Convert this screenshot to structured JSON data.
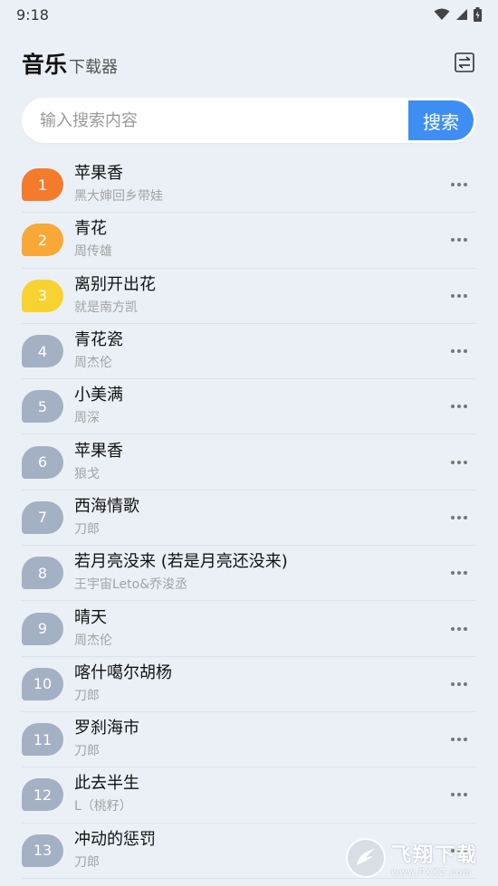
{
  "status_bar": {
    "time": "9:18"
  },
  "header": {
    "title": "音乐",
    "subtitle": "下载器"
  },
  "search": {
    "placeholder": "输入搜索内容",
    "value": "",
    "button_label": "搜索"
  },
  "rank_colors": {
    "1": "#f47a2c",
    "2": "#f8a836",
    "3": "#f8d230",
    "default": "#a4b0c4"
  },
  "songs": [
    {
      "rank": "1",
      "title": "苹果香",
      "artist": "黑大婶回乡带娃"
    },
    {
      "rank": "2",
      "title": "青花",
      "artist": "周传雄"
    },
    {
      "rank": "3",
      "title": "离别开出花",
      "artist": "就是南方凯"
    },
    {
      "rank": "4",
      "title": "青花瓷",
      "artist": "周杰伦"
    },
    {
      "rank": "5",
      "title": "小美满",
      "artist": "周深"
    },
    {
      "rank": "6",
      "title": "苹果香",
      "artist": "狼戈"
    },
    {
      "rank": "7",
      "title": "西海情歌",
      "artist": "刀郎"
    },
    {
      "rank": "8",
      "title": "若月亮没来 (若是月亮还没来)",
      "artist": "王宇宙Leto&乔浚丞"
    },
    {
      "rank": "9",
      "title": "晴天",
      "artist": "周杰伦"
    },
    {
      "rank": "10",
      "title": "喀什噶尔胡杨",
      "artist": "刀郎"
    },
    {
      "rank": "11",
      "title": "罗刹海市",
      "artist": "刀郎"
    },
    {
      "rank": "12",
      "title": "此去半生",
      "artist": "L（桃籽）"
    },
    {
      "rank": "13",
      "title": "冲动的惩罚",
      "artist": "刀郎"
    }
  ],
  "watermark": {
    "title": "飞翔下载",
    "url": "www.FXXZ.com"
  }
}
